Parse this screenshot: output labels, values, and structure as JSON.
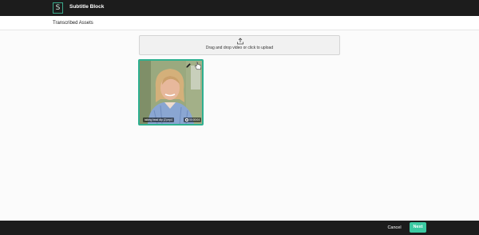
{
  "app": {
    "title": "Subtitle Block",
    "logo_letter": "S",
    "accent": "#3cc9a2"
  },
  "subheader": {
    "title": "Transcribed Assets"
  },
  "upload": {
    "text": "Drag and drop video or click to upload",
    "icon": "upload-icon"
  },
  "assets": [
    {
      "label": "talking head clip (2).mp4",
      "duration": "00:00:04",
      "selected": true
    }
  ],
  "footer": {
    "cancel_label": "Cancel",
    "next_label": "Next"
  }
}
